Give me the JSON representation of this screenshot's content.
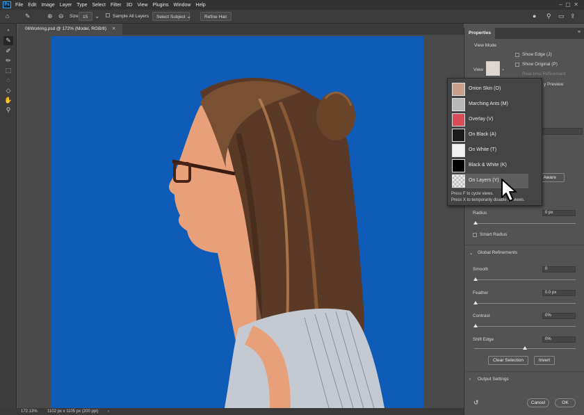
{
  "menubar": {
    "logo": "Ps",
    "items": [
      "File",
      "Edit",
      "Image",
      "Layer",
      "Type",
      "Select",
      "Filter",
      "3D",
      "View",
      "Plugins",
      "Window",
      "Help"
    ]
  },
  "options": {
    "size_label": "Size:",
    "size_value": "15",
    "sample_all_layers": "Sample All Layers",
    "select_subject": "Select Subject",
    "refine_hair": "Refine Hair"
  },
  "document": {
    "tab_title": "06Working.psd @ 172% (Model, RGB/8)"
  },
  "status": {
    "zoom": "172.13%",
    "doc_info": "1102 px x 1105 px (200 ppi)"
  },
  "properties": {
    "tab": "Properties",
    "view_mode_label": "View Mode",
    "view_label": "View",
    "show_edge": "Show Edge (J)",
    "show_original": "Show Original (P)",
    "real_time_refinement": "Real-time Refinement",
    "preview_partial": "y Preview",
    "object_aware_partial": "ct Aware",
    "radius_label": "Radius",
    "radius_value": "0 px",
    "smart_radius": "Smart Radius",
    "global_refinements": "Global Refinements",
    "smooth_label": "Smooth",
    "smooth_value": "0",
    "feather_label": "Feather",
    "feather_value": "0.0 px",
    "contrast_label": "Contrast",
    "contrast_value": "0%",
    "shift_edge_label": "Shift Edge",
    "shift_edge_value": "0%",
    "shift_edge_level": 0.5,
    "clear_selection": "Clear Selection",
    "invert": "Invert",
    "output_settings": "Output Settings",
    "cancel": "Cancel",
    "ok": "OK"
  },
  "view_menu": {
    "items": [
      {
        "label": "Onion Skin (O)",
        "thumb": "#c9a08a"
      },
      {
        "label": "Marching Ants (M)",
        "thumb": "#b8b8b8"
      },
      {
        "label": "Overlay (V)",
        "thumb": "#d94d5a"
      },
      {
        "label": "On Black (A)",
        "thumb": "#1a1a1a"
      },
      {
        "label": "On White (T)",
        "thumb": "#f2f2f2"
      },
      {
        "label": "Black & White (K)",
        "thumb": "#000000"
      },
      {
        "label": "On Layers (Y)",
        "thumb": "#cccccc"
      }
    ],
    "hint1": "Press F to cycle views.",
    "hint2": "Press X to temporarily disable all views."
  },
  "colors": {
    "canvas_bg": "#0f5cb8",
    "accent": "#31a8ff"
  }
}
